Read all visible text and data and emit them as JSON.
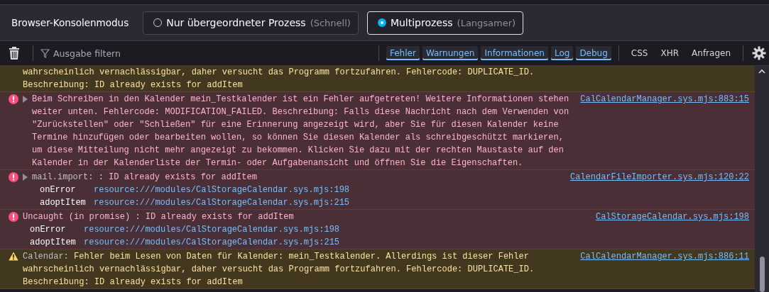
{
  "mode_bar": {
    "label": "Browser-Konsolenmodus",
    "options": [
      {
        "label": "Nur übergeordneter Prozess",
        "hint": "(Schnell)",
        "selected": false
      },
      {
        "label": "Multiprozess",
        "hint": "(Langsamer)",
        "selected": true
      }
    ]
  },
  "toolbar": {
    "filter_placeholder": "Ausgabe filtern",
    "levels": [
      {
        "label": "Fehler",
        "selected": true
      },
      {
        "label": "Warnungen",
        "selected": true
      },
      {
        "label": "Informationen",
        "selected": true
      },
      {
        "label": "Log",
        "selected": true
      },
      {
        "label": "Debug",
        "selected": true
      }
    ],
    "categories": [
      {
        "label": "CSS",
        "selected": false
      },
      {
        "label": "XHR",
        "selected": false
      },
      {
        "label": "Anfragen",
        "selected": false
      }
    ]
  },
  "messages": [
    {
      "kind": "warning",
      "clipped": true,
      "text": "wahrscheinlich vernachlässigbar, daher versucht das Programm fortzufahren. Fehlercode: DUPLICATE_ID. Beschreibung: ID already exists for addItem",
      "expander": false
    },
    {
      "kind": "error",
      "clipped": false,
      "text": "Beim Schreiben in den Kalender mein_Testkalender ist ein Fehler aufgetreten! Weitere Informationen stehen weiter unten. Fehlercode: MODIFICATION_FAILED. Beschreibung: Falls diese Nachricht nach dem Verwenden von \"Zurückstellen\" oder \"Schließen\" für eine Erinnerung angezeigt wird, aber Sie für diesen Kalender keine Termine hinzufügen oder bearbeiten wollen, so können Sie diesen Kalender als schreibgeschützt markieren, um diese Mitteilung nicht mehr angezeigt zu bekommen. Klicken Sie dazu mit der rechten Maustaste auf den Kalender in der Kalenderliste der Termin- oder Aufgabenansicht und öffnen Sie die Eigenschaften.",
      "expander": true,
      "source": "CalCalendarManager.sys.mjs:883:15"
    },
    {
      "kind": "error",
      "clipped": false,
      "prefix": "mail.import:",
      "text": ": ID already exists for addItem",
      "expander": true,
      "source": "CalendarFileImporter.sys.mjs:120:22",
      "stack": [
        {
          "fn": "onError",
          "url": "resource:///modules/CalStorageCalendar.sys.mjs:198"
        },
        {
          "fn": "adoptItem",
          "url": "resource:///modules/CalStorageCalendar.sys.mjs:215"
        }
      ]
    },
    {
      "kind": "error",
      "clipped": false,
      "text": "Uncaught (in promise) : ID already exists for addItem",
      "expander": false,
      "source": "CalStorageCalendar.sys.mjs:198",
      "stack": [
        {
          "fn": "onError",
          "url": "resource:///modules/CalStorageCalendar.sys.mjs:198"
        },
        {
          "fn": "adoptItem",
          "url": "resource:///modules/CalStorageCalendar.sys.mjs:215"
        }
      ]
    },
    {
      "kind": "warning",
      "clipped": false,
      "prefix": "Calendar:",
      "text": "Fehler beim Lesen von Daten für Kalender: mein_Testkalender. Allerdings ist dieser Fehler wahrscheinlich vernachlässigbar, daher versucht das Programm fortzufahren. Fehlercode: DUPLICATE_ID. Beschreibung: ID already exists for addItem",
      "expander": false,
      "source": "CalCalendarManager.sys.mjs:886:11"
    }
  ]
}
